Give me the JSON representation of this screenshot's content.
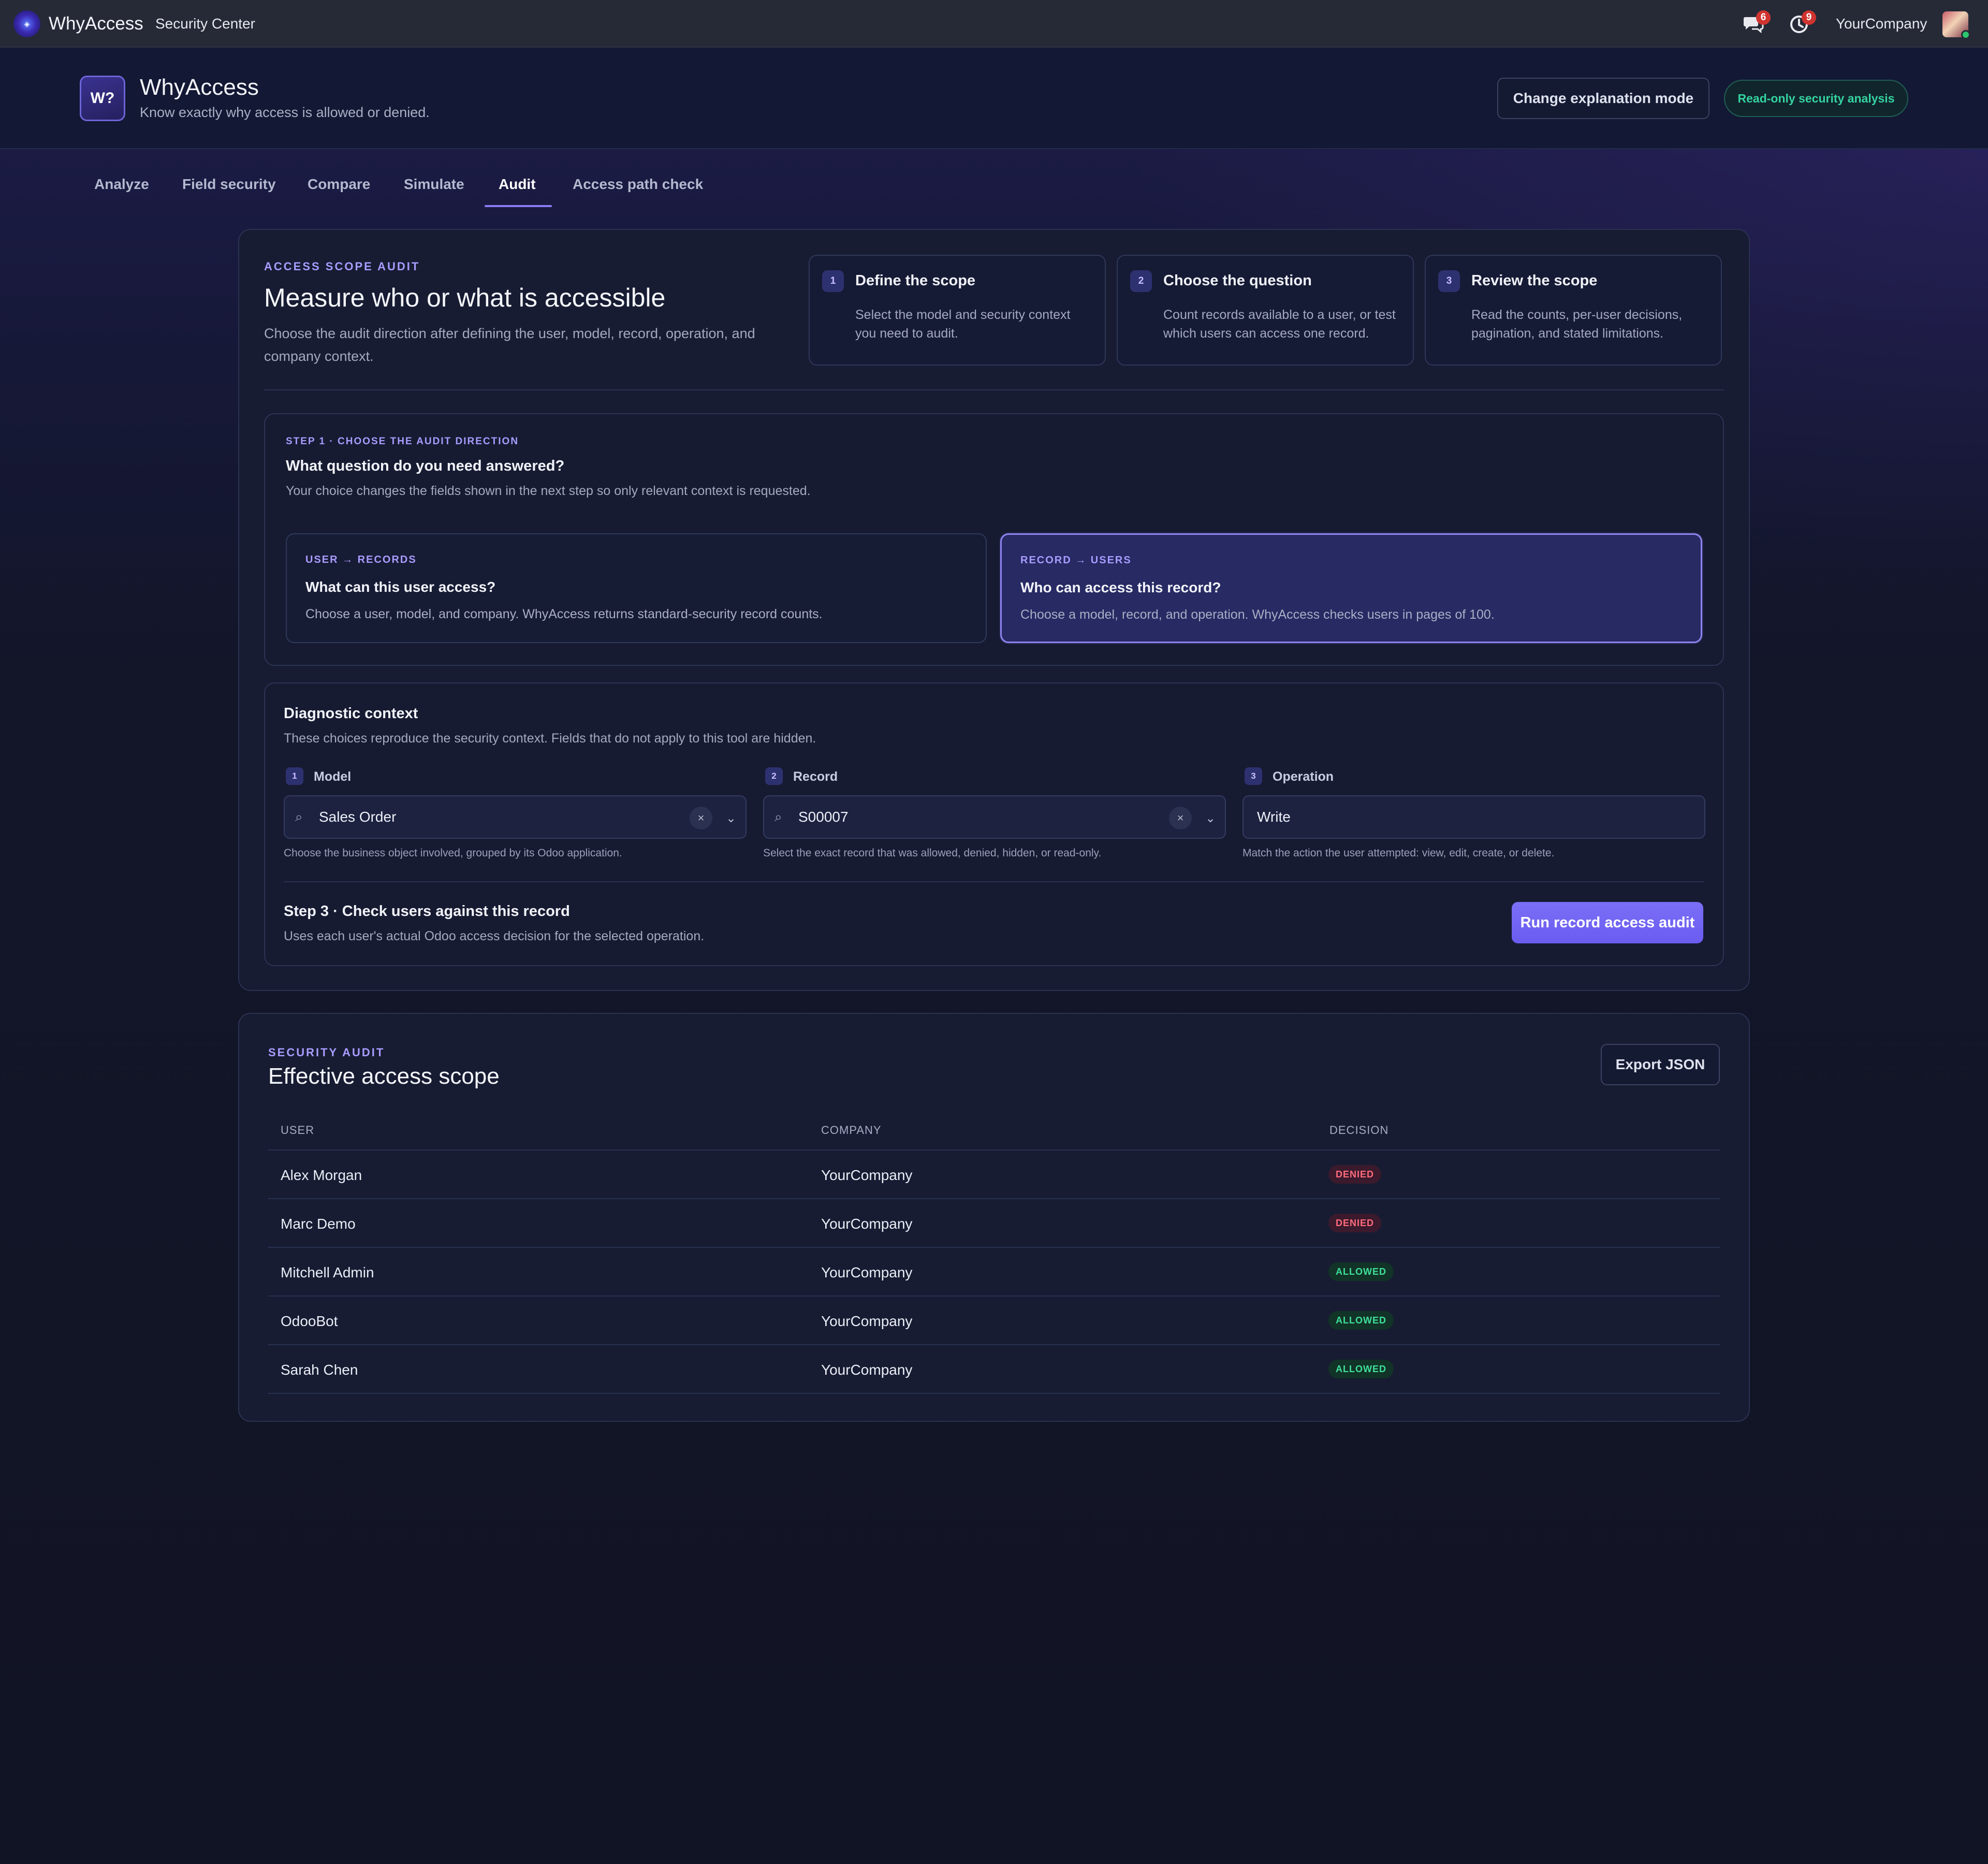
{
  "topbar": {
    "brand": "WhyAccess",
    "menu": "Security Center",
    "messages_count": "6",
    "activity_count": "9",
    "company": "YourCompany"
  },
  "app_header": {
    "logo_text": "W?",
    "title": "WhyAccess",
    "subtitle": "Know exactly why access is allowed or denied.",
    "change_mode_label": "Change explanation mode",
    "readonly_label": "Read-only security analysis"
  },
  "tabs": [
    {
      "label": "Analyze"
    },
    {
      "label": "Field security"
    },
    {
      "label": "Compare"
    },
    {
      "label": "Simulate"
    },
    {
      "label": "Audit",
      "active": true
    },
    {
      "label": "Access path check"
    }
  ],
  "audit_card": {
    "eyebrow": "ACCESS SCOPE AUDIT",
    "title": "Measure who or what is accessible",
    "description": "Choose the audit direction after defining the user, model, record, operation, and company context.",
    "steps": [
      {
        "num": "1",
        "title": "Define the scope",
        "desc": "Select the model and security context you need to audit."
      },
      {
        "num": "2",
        "title": "Choose the question",
        "desc": "Count records available to a user, or test which users can access one record."
      },
      {
        "num": "3",
        "title": "Review the scope",
        "desc": "Read the counts, per-user decisions, pagination, and stated limitations."
      }
    ]
  },
  "direction": {
    "eyebrow": "STEP 1 · CHOOSE THE AUDIT DIRECTION",
    "title": "What question do you need answered?",
    "description": "Your choice changes the fields shown in the next step so only relevant context is requested.",
    "options": [
      {
        "eyebrow": "USER → RECORDS",
        "title": "What can this user access?",
        "desc": "Choose a user, model, and company. WhyAccess returns standard-security record counts."
      },
      {
        "eyebrow": "RECORD → USERS",
        "title": "Who can access this record?",
        "desc": "Choose a model, record, and operation. WhyAccess checks users in pages of 100.",
        "selected": true
      }
    ]
  },
  "context": {
    "title": "Diagnostic context",
    "description": "These choices reproduce the security context. Fields that do not apply to this tool are hidden.",
    "fields": [
      {
        "num": "1",
        "label": "Model",
        "value": "Sales Order",
        "help": "Choose the business object involved, grouped by its Odoo application."
      },
      {
        "num": "2",
        "label": "Record",
        "value": "S00007",
        "help": "Select the exact record that was allowed, denied, hidden, or read-only."
      },
      {
        "num": "3",
        "label": "Operation",
        "value": "Write",
        "help": "Match the action the user attempted: view, edit, create, or delete."
      }
    ],
    "step3_title": "Step 3 · Check users against this record",
    "step3_desc": "Uses each user's actual Odoo access decision for the selected operation.",
    "run_label": "Run record access audit"
  },
  "results": {
    "eyebrow": "SECURITY AUDIT",
    "title": "Effective access scope",
    "export_label": "Export JSON",
    "columns": [
      "USER",
      "COMPANY",
      "DECISION"
    ],
    "rows": [
      {
        "user": "Alex Morgan",
        "company": "YourCompany",
        "decision": "DENIED"
      },
      {
        "user": "Marc Demo",
        "company": "YourCompany",
        "decision": "DENIED"
      },
      {
        "user": "Mitchell Admin",
        "company": "YourCompany",
        "decision": "ALLOWED"
      },
      {
        "user": "OdooBot",
        "company": "YourCompany",
        "decision": "ALLOWED"
      },
      {
        "user": "Sarah Chen",
        "company": "YourCompany",
        "decision": "ALLOWED"
      }
    ]
  },
  "colors": {
    "accent": "#7a6ff7",
    "denied": "#ff6b7d",
    "allowed": "#3fe09b",
    "readonly": "#34d3a0"
  }
}
